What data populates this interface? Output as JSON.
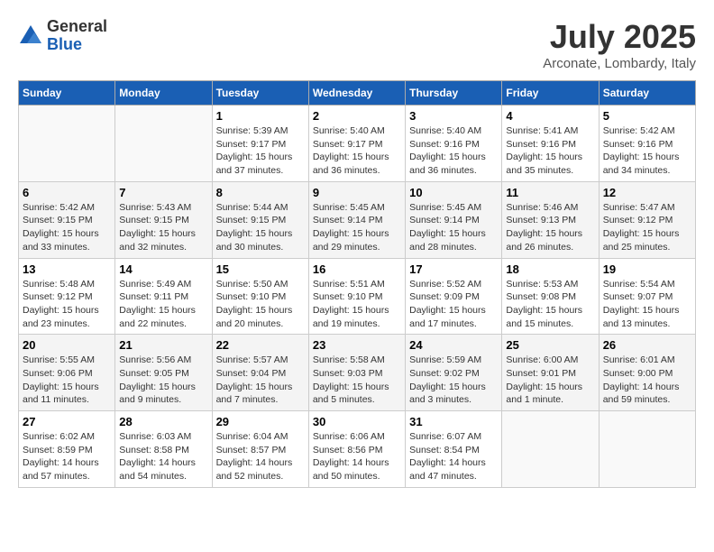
{
  "header": {
    "logo_general": "General",
    "logo_blue": "Blue",
    "month_title": "July 2025",
    "location": "Arconate, Lombardy, Italy"
  },
  "weekdays": [
    "Sunday",
    "Monday",
    "Tuesday",
    "Wednesday",
    "Thursday",
    "Friday",
    "Saturday"
  ],
  "weeks": [
    [
      {
        "day": "",
        "sunrise": "",
        "sunset": "",
        "daylight": "",
        "empty": true
      },
      {
        "day": "",
        "sunrise": "",
        "sunset": "",
        "daylight": "",
        "empty": true
      },
      {
        "day": "1",
        "sunrise": "Sunrise: 5:39 AM",
        "sunset": "Sunset: 9:17 PM",
        "daylight": "Daylight: 15 hours and 37 minutes."
      },
      {
        "day": "2",
        "sunrise": "Sunrise: 5:40 AM",
        "sunset": "Sunset: 9:17 PM",
        "daylight": "Daylight: 15 hours and 36 minutes."
      },
      {
        "day": "3",
        "sunrise": "Sunrise: 5:40 AM",
        "sunset": "Sunset: 9:16 PM",
        "daylight": "Daylight: 15 hours and 36 minutes."
      },
      {
        "day": "4",
        "sunrise": "Sunrise: 5:41 AM",
        "sunset": "Sunset: 9:16 PM",
        "daylight": "Daylight: 15 hours and 35 minutes."
      },
      {
        "day": "5",
        "sunrise": "Sunrise: 5:42 AM",
        "sunset": "Sunset: 9:16 PM",
        "daylight": "Daylight: 15 hours and 34 minutes."
      }
    ],
    [
      {
        "day": "6",
        "sunrise": "Sunrise: 5:42 AM",
        "sunset": "Sunset: 9:15 PM",
        "daylight": "Daylight: 15 hours and 33 minutes."
      },
      {
        "day": "7",
        "sunrise": "Sunrise: 5:43 AM",
        "sunset": "Sunset: 9:15 PM",
        "daylight": "Daylight: 15 hours and 32 minutes."
      },
      {
        "day": "8",
        "sunrise": "Sunrise: 5:44 AM",
        "sunset": "Sunset: 9:15 PM",
        "daylight": "Daylight: 15 hours and 30 minutes."
      },
      {
        "day": "9",
        "sunrise": "Sunrise: 5:45 AM",
        "sunset": "Sunset: 9:14 PM",
        "daylight": "Daylight: 15 hours and 29 minutes."
      },
      {
        "day": "10",
        "sunrise": "Sunrise: 5:45 AM",
        "sunset": "Sunset: 9:14 PM",
        "daylight": "Daylight: 15 hours and 28 minutes."
      },
      {
        "day": "11",
        "sunrise": "Sunrise: 5:46 AM",
        "sunset": "Sunset: 9:13 PM",
        "daylight": "Daylight: 15 hours and 26 minutes."
      },
      {
        "day": "12",
        "sunrise": "Sunrise: 5:47 AM",
        "sunset": "Sunset: 9:12 PM",
        "daylight": "Daylight: 15 hours and 25 minutes."
      }
    ],
    [
      {
        "day": "13",
        "sunrise": "Sunrise: 5:48 AM",
        "sunset": "Sunset: 9:12 PM",
        "daylight": "Daylight: 15 hours and 23 minutes."
      },
      {
        "day": "14",
        "sunrise": "Sunrise: 5:49 AM",
        "sunset": "Sunset: 9:11 PM",
        "daylight": "Daylight: 15 hours and 22 minutes."
      },
      {
        "day": "15",
        "sunrise": "Sunrise: 5:50 AM",
        "sunset": "Sunset: 9:10 PM",
        "daylight": "Daylight: 15 hours and 20 minutes."
      },
      {
        "day": "16",
        "sunrise": "Sunrise: 5:51 AM",
        "sunset": "Sunset: 9:10 PM",
        "daylight": "Daylight: 15 hours and 19 minutes."
      },
      {
        "day": "17",
        "sunrise": "Sunrise: 5:52 AM",
        "sunset": "Sunset: 9:09 PM",
        "daylight": "Daylight: 15 hours and 17 minutes."
      },
      {
        "day": "18",
        "sunrise": "Sunrise: 5:53 AM",
        "sunset": "Sunset: 9:08 PM",
        "daylight": "Daylight: 15 hours and 15 minutes."
      },
      {
        "day": "19",
        "sunrise": "Sunrise: 5:54 AM",
        "sunset": "Sunset: 9:07 PM",
        "daylight": "Daylight: 15 hours and 13 minutes."
      }
    ],
    [
      {
        "day": "20",
        "sunrise": "Sunrise: 5:55 AM",
        "sunset": "Sunset: 9:06 PM",
        "daylight": "Daylight: 15 hours and 11 minutes."
      },
      {
        "day": "21",
        "sunrise": "Sunrise: 5:56 AM",
        "sunset": "Sunset: 9:05 PM",
        "daylight": "Daylight: 15 hours and 9 minutes."
      },
      {
        "day": "22",
        "sunrise": "Sunrise: 5:57 AM",
        "sunset": "Sunset: 9:04 PM",
        "daylight": "Daylight: 15 hours and 7 minutes."
      },
      {
        "day": "23",
        "sunrise": "Sunrise: 5:58 AM",
        "sunset": "Sunset: 9:03 PM",
        "daylight": "Daylight: 15 hours and 5 minutes."
      },
      {
        "day": "24",
        "sunrise": "Sunrise: 5:59 AM",
        "sunset": "Sunset: 9:02 PM",
        "daylight": "Daylight: 15 hours and 3 minutes."
      },
      {
        "day": "25",
        "sunrise": "Sunrise: 6:00 AM",
        "sunset": "Sunset: 9:01 PM",
        "daylight": "Daylight: 15 hours and 1 minute."
      },
      {
        "day": "26",
        "sunrise": "Sunrise: 6:01 AM",
        "sunset": "Sunset: 9:00 PM",
        "daylight": "Daylight: 14 hours and 59 minutes."
      }
    ],
    [
      {
        "day": "27",
        "sunrise": "Sunrise: 6:02 AM",
        "sunset": "Sunset: 8:59 PM",
        "daylight": "Daylight: 14 hours and 57 minutes."
      },
      {
        "day": "28",
        "sunrise": "Sunrise: 6:03 AM",
        "sunset": "Sunset: 8:58 PM",
        "daylight": "Daylight: 14 hours and 54 minutes."
      },
      {
        "day": "29",
        "sunrise": "Sunrise: 6:04 AM",
        "sunset": "Sunset: 8:57 PM",
        "daylight": "Daylight: 14 hours and 52 minutes."
      },
      {
        "day": "30",
        "sunrise": "Sunrise: 6:06 AM",
        "sunset": "Sunset: 8:56 PM",
        "daylight": "Daylight: 14 hours and 50 minutes."
      },
      {
        "day": "31",
        "sunrise": "Sunrise: 6:07 AM",
        "sunset": "Sunset: 8:54 PM",
        "daylight": "Daylight: 14 hours and 47 minutes."
      },
      {
        "day": "",
        "sunrise": "",
        "sunset": "",
        "daylight": "",
        "empty": true
      },
      {
        "day": "",
        "sunrise": "",
        "sunset": "",
        "daylight": "",
        "empty": true
      }
    ]
  ]
}
